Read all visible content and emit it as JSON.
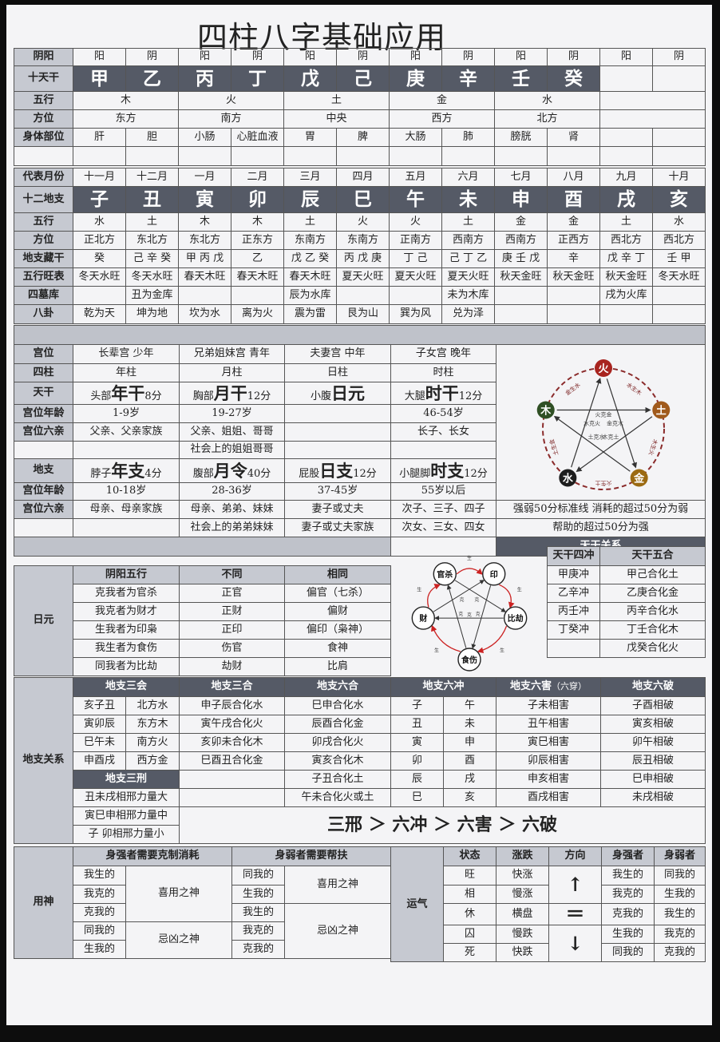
{
  "title": "四柱八字基础应用",
  "top": {
    "yinyang": {
      "label": "阴阳",
      "values": [
        "阳",
        "阴",
        "阳",
        "阴",
        "阳",
        "阴",
        "阳",
        "阴",
        "阳",
        "阴",
        "阳",
        "阴"
      ]
    },
    "stems": {
      "label": "十天干",
      "values": [
        "甲",
        "乙",
        "丙",
        "丁",
        "戊",
        "己",
        "庚",
        "辛",
        "壬",
        "癸"
      ]
    },
    "wuxing": {
      "label": "五行",
      "values": [
        "木",
        "火",
        "土",
        "金",
        "水"
      ]
    },
    "direction": {
      "label": "方位",
      "values": [
        "东方",
        "南方",
        "中央",
        "西方",
        "北方"
      ]
    },
    "body": {
      "label": "身体部位",
      "values": [
        "肝",
        "胆",
        "小肠",
        "心脏血液",
        "胃",
        "脾",
        "大肠",
        "肺",
        "膀胱",
        "肾"
      ]
    }
  },
  "mid": {
    "months": {
      "label": "代表月份",
      "values": [
        "十一月",
        "十二月",
        "一月",
        "二月",
        "三月",
        "四月",
        "五月",
        "六月",
        "七月",
        "八月",
        "九月",
        "十月"
      ]
    },
    "branches": {
      "label": "十二地支",
      "values": [
        "子",
        "丑",
        "寅",
        "卯",
        "辰",
        "巳",
        "午",
        "未",
        "申",
        "酉",
        "戌",
        "亥"
      ]
    },
    "wuxing": {
      "label": "五行",
      "values": [
        "水",
        "土",
        "木",
        "木",
        "土",
        "火",
        "火",
        "土",
        "金",
        "金",
        "土",
        "水"
      ]
    },
    "direction": {
      "label": "方位",
      "values": [
        "正北方",
        "东北方",
        "东北方",
        "正东方",
        "东南方",
        "东南方",
        "正南方",
        "西南方",
        "西南方",
        "正西方",
        "西北方",
        "西北方"
      ]
    },
    "hidden": {
      "label": "地支藏干",
      "values": [
        "癸",
        "己 辛 癸",
        "甲 丙 戊",
        "乙",
        "戊 乙 癸",
        "丙 戊 庚",
        "丁 己",
        "己 丁 乙",
        "庚 壬 戊",
        "辛",
        "戊 辛 丁",
        "壬 甲"
      ]
    },
    "season": {
      "label": "五行旺表",
      "values": [
        "冬天水旺",
        "冬天水旺",
        "春天木旺",
        "春天木旺",
        "春天木旺",
        "夏天火旺",
        "夏天火旺",
        "夏天火旺",
        "秋天金旺",
        "秋天金旺",
        "秋天金旺",
        "冬天水旺"
      ]
    },
    "tomb": {
      "label": "四墓库",
      "values": [
        "丑为金库",
        "辰为水库",
        "未为木库",
        "戌为火库"
      ]
    },
    "bagua": {
      "label": "八卦",
      "values": [
        "乾为天",
        "坤为地",
        "坎为水",
        "离为火",
        "震为雷",
        "艮为山",
        "巽为风",
        "兑为泽"
      ]
    }
  },
  "pillars": {
    "palace": {
      "label": "宫位",
      "values": [
        "长辈宫 少年",
        "兄弟姐妹宫 青年",
        "夫妻宫 中年",
        "子女宫 晚年"
      ]
    },
    "four": {
      "label": "四柱",
      "values": [
        "年柱",
        "月柱",
        "日柱",
        "时柱"
      ]
    },
    "stem": {
      "label": "天干",
      "cells": [
        {
          "pre": "头部",
          "big": "年干",
          "post": "8分"
        },
        {
          "pre": "胸部",
          "big": "月干",
          "post": "12分"
        },
        {
          "pre": "小腹",
          "big": "日元",
          "post": ""
        },
        {
          "pre": "大腿",
          "big": "时干",
          "post": "12分"
        }
      ]
    },
    "age1": {
      "label": "宫位年龄",
      "values": [
        "1-9岁",
        "19-27岁",
        "",
        "46-54岁"
      ]
    },
    "kin1": {
      "label": "宫位六亲",
      "values": [
        "父亲、父亲家族",
        "父亲、姐姐、哥哥",
        "",
        "长子、长女"
      ]
    },
    "kin1b": "社会上的姐姐哥哥",
    "branch": {
      "label": "地支",
      "cells": [
        {
          "pre": "脖子",
          "big": "年支",
          "post": "4分"
        },
        {
          "pre": "腹部",
          "big": "月令",
          "post": "40分"
        },
        {
          "pre": "屁股",
          "big": "日支",
          "post": "12分"
        },
        {
          "pre": "小腿脚",
          "big": "时支",
          "post": "12分"
        }
      ]
    },
    "age2": {
      "label": "宫位年龄",
      "values": [
        "10-18岁",
        "28-36岁",
        "37-45岁",
        "55岁以后"
      ]
    },
    "kin2": {
      "label": "宫位六亲",
      "values": [
        "母亲、母亲家族",
        "母亲、弟弟、妹妹",
        "妻子或丈夫",
        "次子、三子、四子"
      ]
    },
    "kin2b": [
      "社会上的弟弟妹妹",
      "妻子或丈夫家族",
      "次女、三女、四女"
    ],
    "note1": "强弱50分标准线  消耗的超过50分为弱",
    "note2": "帮助的超过50分为强"
  },
  "wheel1": {
    "fire": "火",
    "earth": "土",
    "metal": "金",
    "water": "水",
    "wood": "木",
    "gens": [
      "木生火",
      "火生土",
      "土生金",
      "金生水",
      "水生木"
    ],
    "ctrls": [
      "木克土",
      "土克水",
      "水克火",
      "火克金",
      "金克木"
    ]
  },
  "wheel2": {
    "nodes": [
      "官杀",
      "印",
      "比劫",
      "食伤",
      "财"
    ],
    "labels": [
      "生",
      "生",
      "生",
      "生",
      "生",
      "克",
      "克",
      "克",
      "克",
      "克"
    ]
  },
  "riyuan": {
    "label": "日元",
    "headers": [
      "阴阳五行",
      "不同",
      "相同"
    ],
    "rows": [
      [
        "克我者为官杀",
        "正官",
        "偏官（七杀）"
      ],
      [
        "我克者为财才",
        "正财",
        "偏财"
      ],
      [
        "生我者为印枭",
        "正印",
        "偏印（枭神）"
      ],
      [
        "我生者为食伤",
        "伤官",
        "食神"
      ],
      [
        "同我者为比劫",
        "劫财",
        "比肩"
      ]
    ]
  },
  "tiangan": {
    "title": "天干关系",
    "h1": "天干四冲",
    "h2": "天干五合",
    "chong": [
      "甲庚冲",
      "乙辛冲",
      "丙壬冲",
      "丁癸冲"
    ],
    "he": [
      "甲己合化土",
      "乙庚合化金",
      "丙辛合化水",
      "丁壬合化木",
      "戊癸合化火"
    ]
  },
  "dizhi": {
    "label": "地支关系",
    "h_sanhui": "地支三会",
    "h_sanhe": "地支三合",
    "h_liuhe": "地支六合",
    "h_liuchong": "地支六冲",
    "h_liuhai": "地支六害",
    "h_liuhai_sub": "（六穿）",
    "h_liupo": "地支六破",
    "h_sanxing": "地支三刑",
    "sanhui": [
      [
        "亥子丑",
        "北方水"
      ],
      [
        "寅卯辰",
        "东方木"
      ],
      [
        "巳午未",
        "南方火"
      ],
      [
        "申酉戌",
        "西方金"
      ]
    ],
    "sanhe": [
      "申子辰合化水",
      "寅午戌合化火",
      "亥卯未合化木",
      "巳酉丑合化金"
    ],
    "liuhe": [
      "巳申合化水",
      "辰酉合化金",
      "卯戌合化火",
      "寅亥合化木",
      "子丑合化土",
      "午未合化火或土"
    ],
    "liuchong": [
      [
        "子",
        "午"
      ],
      [
        "丑",
        "未"
      ],
      [
        "寅",
        "申"
      ],
      [
        "卯",
        "酉"
      ],
      [
        "辰",
        "戌"
      ],
      [
        "巳",
        "亥"
      ]
    ],
    "liuhai": [
      "子未相害",
      "丑午相害",
      "寅巳相害",
      "卯辰相害",
      "申亥相害",
      "酉戌相害"
    ],
    "liupo": [
      "子酉相破",
      "寅亥相破",
      "卯午相破",
      "辰丑相破",
      "巳申相破",
      "未戌相破"
    ],
    "sanxing": [
      "丑未戌相邢力量大",
      "寅巳申相邢力量中",
      "子  卯相邢力量小"
    ],
    "order": "三邢 ＞ 六冲 ＞ 六害 ＞ 六破"
  },
  "yongshen": {
    "label": "用神",
    "strong_h": "身强者需要克制消耗",
    "weak_h": "身弱者需要帮扶",
    "strong": [
      "我生的",
      "我克的",
      "克我的",
      "同我的",
      "生我的"
    ],
    "weak": [
      "同我的",
      "生我的",
      "我生的",
      "我克的",
      "克我的"
    ],
    "xi": "喜用之神",
    "ji": "忌凶之神"
  },
  "yunqi": {
    "label": "运气",
    "headers": [
      "状态",
      "涨跌",
      "方向",
      "身强者",
      "身弱者"
    ],
    "rows": [
      [
        "旺",
        "快涨",
        "我生的",
        "同我的"
      ],
      [
        "相",
        "慢涨",
        "我克的",
        "生我的"
      ],
      [
        "休",
        "横盘",
        "克我的",
        "我生的"
      ],
      [
        "囚",
        "慢跌",
        "生我的",
        "我克的"
      ],
      [
        "死",
        "快跌",
        "同我的",
        "克我的"
      ]
    ],
    "up": "↑",
    "flat": "＝",
    "down": "↓"
  }
}
